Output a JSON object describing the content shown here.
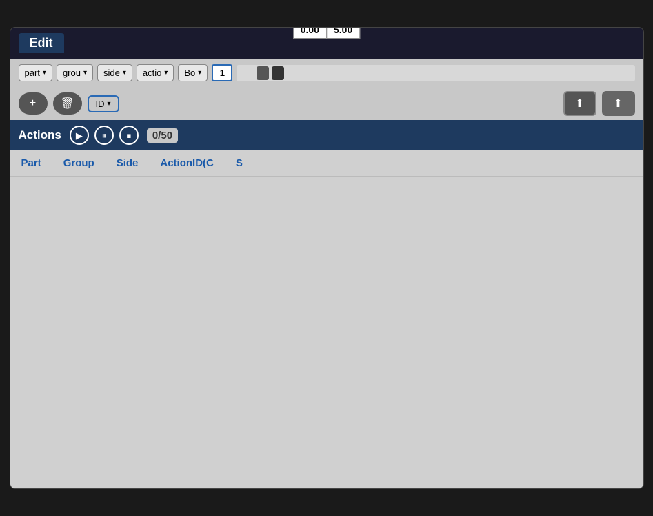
{
  "header": {
    "title": "Edit"
  },
  "time": {
    "left": "0.00",
    "right": "5.00"
  },
  "toolbar1": {
    "dropdown1": "part",
    "dropdown2": "grou",
    "dropdown3": "side",
    "dropdown4": "actio",
    "dropdown5": "Bo",
    "number_value": "1"
  },
  "toolbar2": {
    "add_label": "+",
    "delete_label": "🗑",
    "id_dropdown": "ID",
    "upload1_label": "⬆",
    "upload2_label": "⬆"
  },
  "actions": {
    "title": "Actions",
    "play_label": "▶",
    "pause_label": "⏸",
    "stop_label": "⏹",
    "count": "0/50"
  },
  "table": {
    "columns": [
      "Part",
      "Group",
      "Side",
      "ActionID(C",
      "S"
    ]
  }
}
